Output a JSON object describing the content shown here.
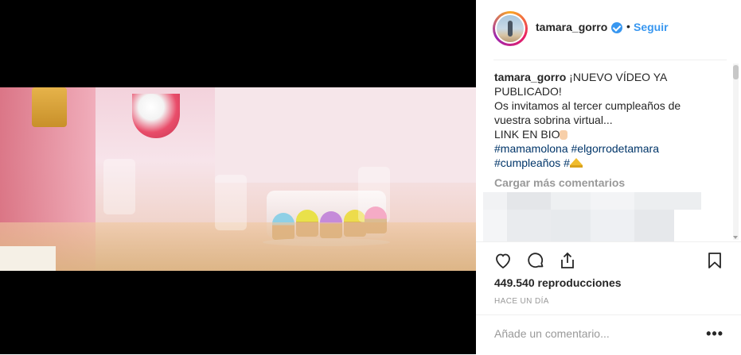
{
  "post": {
    "username": "tamara_gorro",
    "follow_label": "Seguir",
    "separator": "•",
    "caption": {
      "user": "tamara_gorro",
      "line1": "¡NUEVO VÍDEO YA",
      "line2": "PUBLICADO!",
      "line3": "Os invitamos al tercer cumpleaños de",
      "line4": "vuestra sobrina virtual...",
      "line5": "LINK EN BIO",
      "hashtag1": "#mamamolona",
      "hashtag2": "#elgorrodetamara",
      "hashtag3": "#cumpleaños",
      "hashtag4_prefix": "#"
    },
    "load_more_label": "Cargar más comentarios",
    "views": "449.540 reproducciones",
    "timestamp": "HACE UN DÍA",
    "comment_placeholder": "Añade un comentario...",
    "options_label": "•••"
  },
  "icons": {
    "like": "heart-icon",
    "comment": "comment-icon",
    "share": "share-icon",
    "save": "bookmark-icon",
    "verified": "verified-badge-icon"
  },
  "colors": {
    "link": "#3897f0",
    "hashtag": "#003569",
    "muted": "#999999",
    "text": "#262626"
  }
}
